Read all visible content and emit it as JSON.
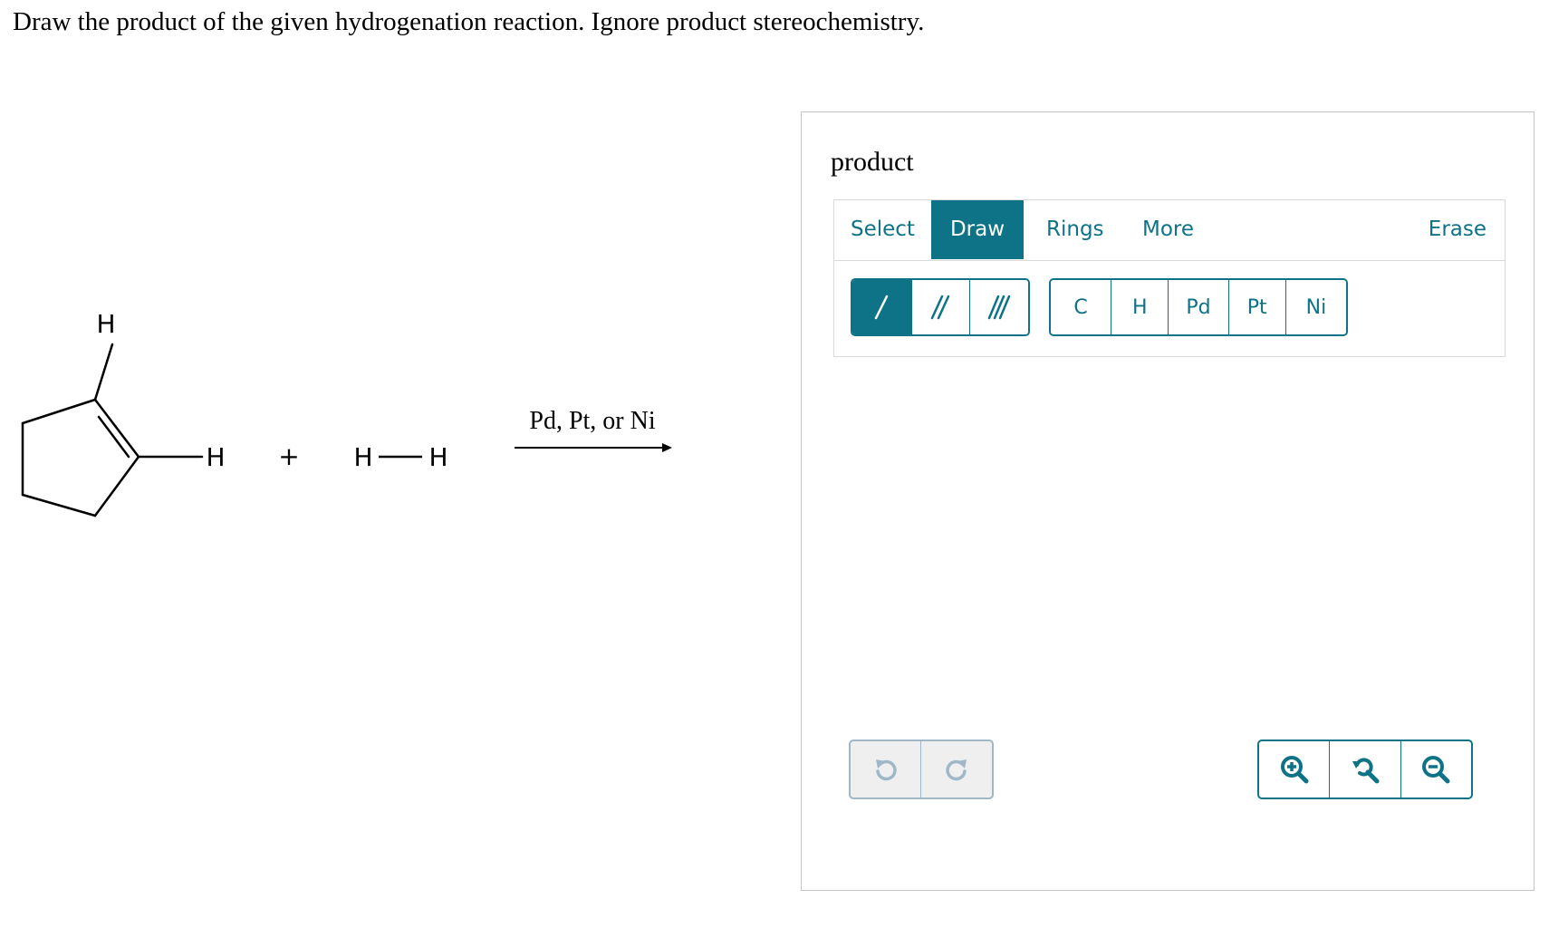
{
  "question": "Draw the product of the given hydrogenation reaction. Ignore product stereochemistry.",
  "reaction": {
    "reactant_atoms": {
      "top_h": "H",
      "right_h": "H"
    },
    "plus": "+",
    "h2": {
      "left": "H",
      "right": "H"
    },
    "conditions": "Pd, Pt, or Ni"
  },
  "panel": {
    "title": "product",
    "tabs": {
      "select": "Select",
      "draw": "Draw",
      "rings": "Rings",
      "more": "More",
      "erase": "Erase"
    },
    "bond_tools": [
      "single-bond",
      "double-bond",
      "triple-bond"
    ],
    "atoms": [
      "C",
      "H",
      "Pd",
      "Pt",
      "Ni"
    ],
    "colors": {
      "accent": "#0e7386",
      "disabled_border": "#9fb7c6",
      "disabled_bg": "#efefef"
    }
  }
}
